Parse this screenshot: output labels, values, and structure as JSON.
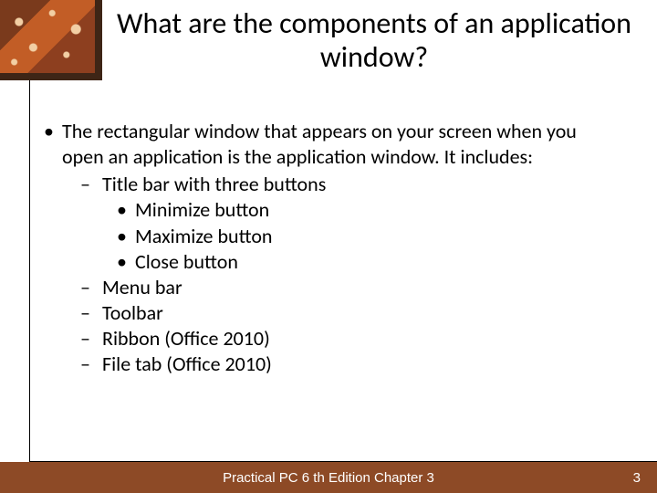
{
  "title": "What are the components of an application window?",
  "bullet": {
    "lead": "The rectangular window that appears on your screen when you open an application is the application window.  It includes:",
    "items": [
      {
        "text": "Title bar with three buttons",
        "sub": [
          "Minimize button",
          "Maximize button",
          "Close button"
        ]
      },
      {
        "text": "Menu bar"
      },
      {
        "text": "Toolbar"
      },
      {
        "text": "Ribbon (Office 2010)"
      },
      {
        "text": "File tab (Office 2010)"
      }
    ]
  },
  "footer": {
    "text": "Practical PC 6 th Edition Chapter 3",
    "page": "3"
  }
}
